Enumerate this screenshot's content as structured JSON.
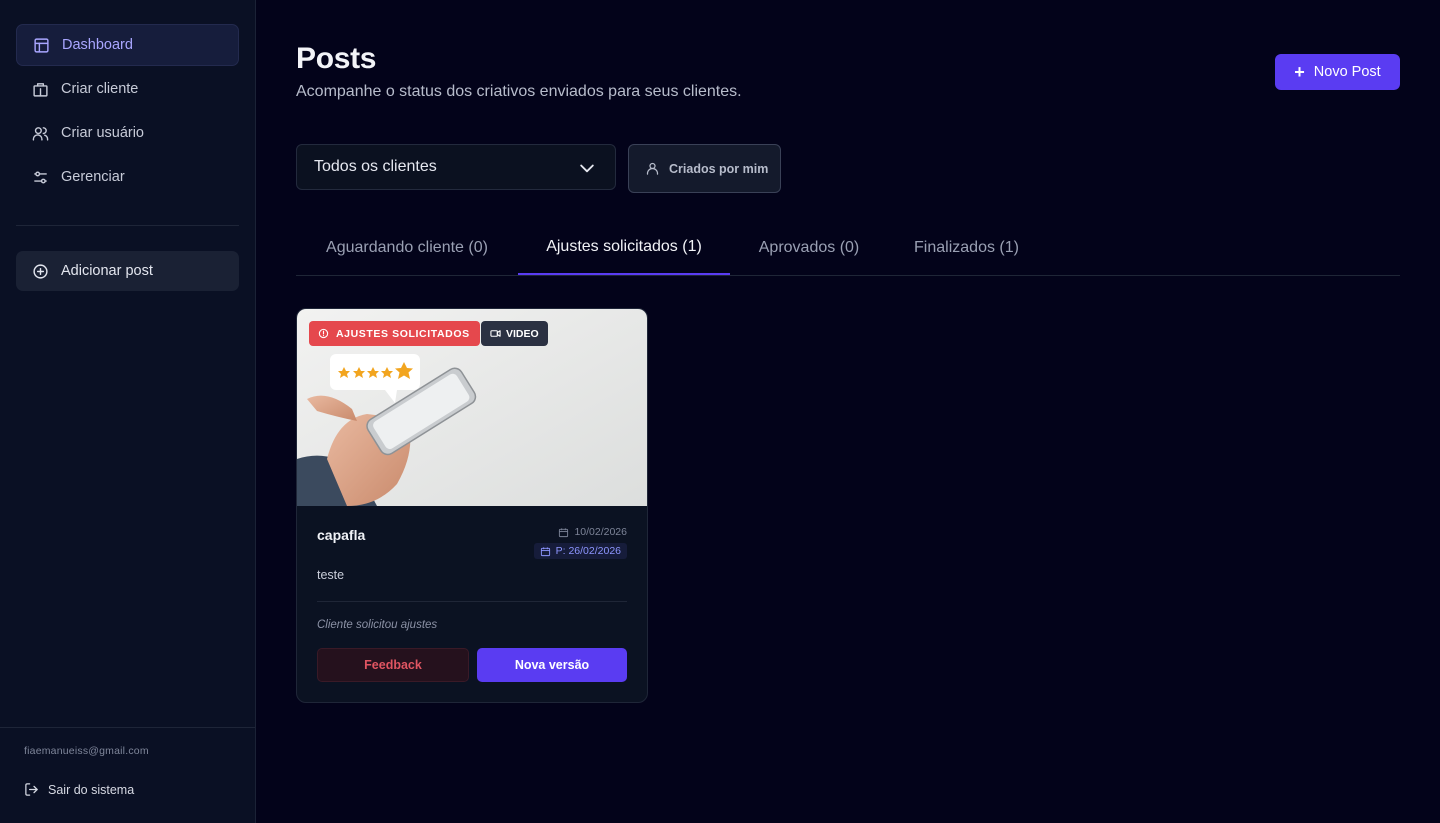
{
  "sidebar": {
    "items": [
      {
        "label": "Dashboard",
        "icon": "layout-icon",
        "active": true
      },
      {
        "label": "Criar cliente",
        "icon": "building-icon"
      },
      {
        "label": "Criar usuário",
        "icon": "users-icon"
      },
      {
        "label": "Gerenciar",
        "icon": "sliders-icon"
      }
    ],
    "add_post": {
      "label": "Adicionar post",
      "icon": "plus-circle-icon"
    },
    "user_email": "fiaemanueiss@gmail.com",
    "logout_label": "Sair do sistema"
  },
  "header": {
    "title": "Posts",
    "subtitle": "Acompanhe o status dos criativos enviados para seus clientes.",
    "new_post_label": "Novo Post"
  },
  "filters": {
    "client_select_value": "Todos os clientes",
    "mine_label": "Criados por mim"
  },
  "tabs": [
    {
      "label": "Aguardando cliente (0)"
    },
    {
      "label": "Ajustes solicitados (1)",
      "active": true
    },
    {
      "label": "Aprovados (0)"
    },
    {
      "label": "Finalizados (1)"
    }
  ],
  "cards": [
    {
      "status_badge": "AJUSTES SOLICITADOS",
      "type_badge": "VIDEO",
      "title": "capafla",
      "created_date": "10/02/2026",
      "publish_date": "P: 26/02/2026",
      "description": "teste",
      "status_text": "Cliente solicitou ajustes",
      "feedback_label": "Feedback",
      "new_version_label": "Nova versão"
    }
  ],
  "colors": {
    "accent": "#5a3cf2",
    "danger": "#e5484d",
    "background": "#03031a",
    "sidebar": "#0a1024"
  }
}
